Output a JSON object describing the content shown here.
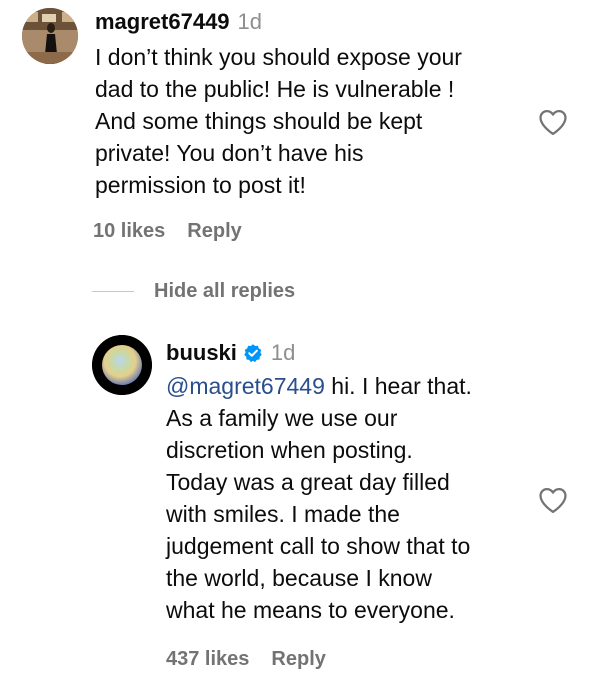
{
  "comments": [
    {
      "username": "magret67449",
      "time": "1d",
      "lines": [
        "I don’t think you should expose your",
        "dad to the public! He is vulnerable !",
        "And some things should be kept",
        "private! You don’t have his",
        "permission to post it!"
      ],
      "likes": "10 likes",
      "reply_label": "Reply"
    }
  ],
  "thread": {
    "hide_replies_label": "Hide all replies"
  },
  "replies": [
    {
      "username": "buuski",
      "verified": true,
      "time": "1d",
      "mention": "@magret67449",
      "first_line_rest": " hi. I hear that.",
      "lines": [
        "As a family we use our",
        "discretion when posting.",
        "Today was a great day filled",
        "with smiles. I made the",
        "judgement call to show that to",
        "the world, because I know",
        "what he means to everyone."
      ],
      "likes": "437 likes",
      "reply_label": "Reply"
    }
  ],
  "icons": {
    "like": "heart-outline-icon",
    "verified": "verified-badge-icon"
  },
  "colors": {
    "verified_blue": "#0095f6",
    "mention": "#2a4e8c",
    "meta_gray": "#737373"
  }
}
